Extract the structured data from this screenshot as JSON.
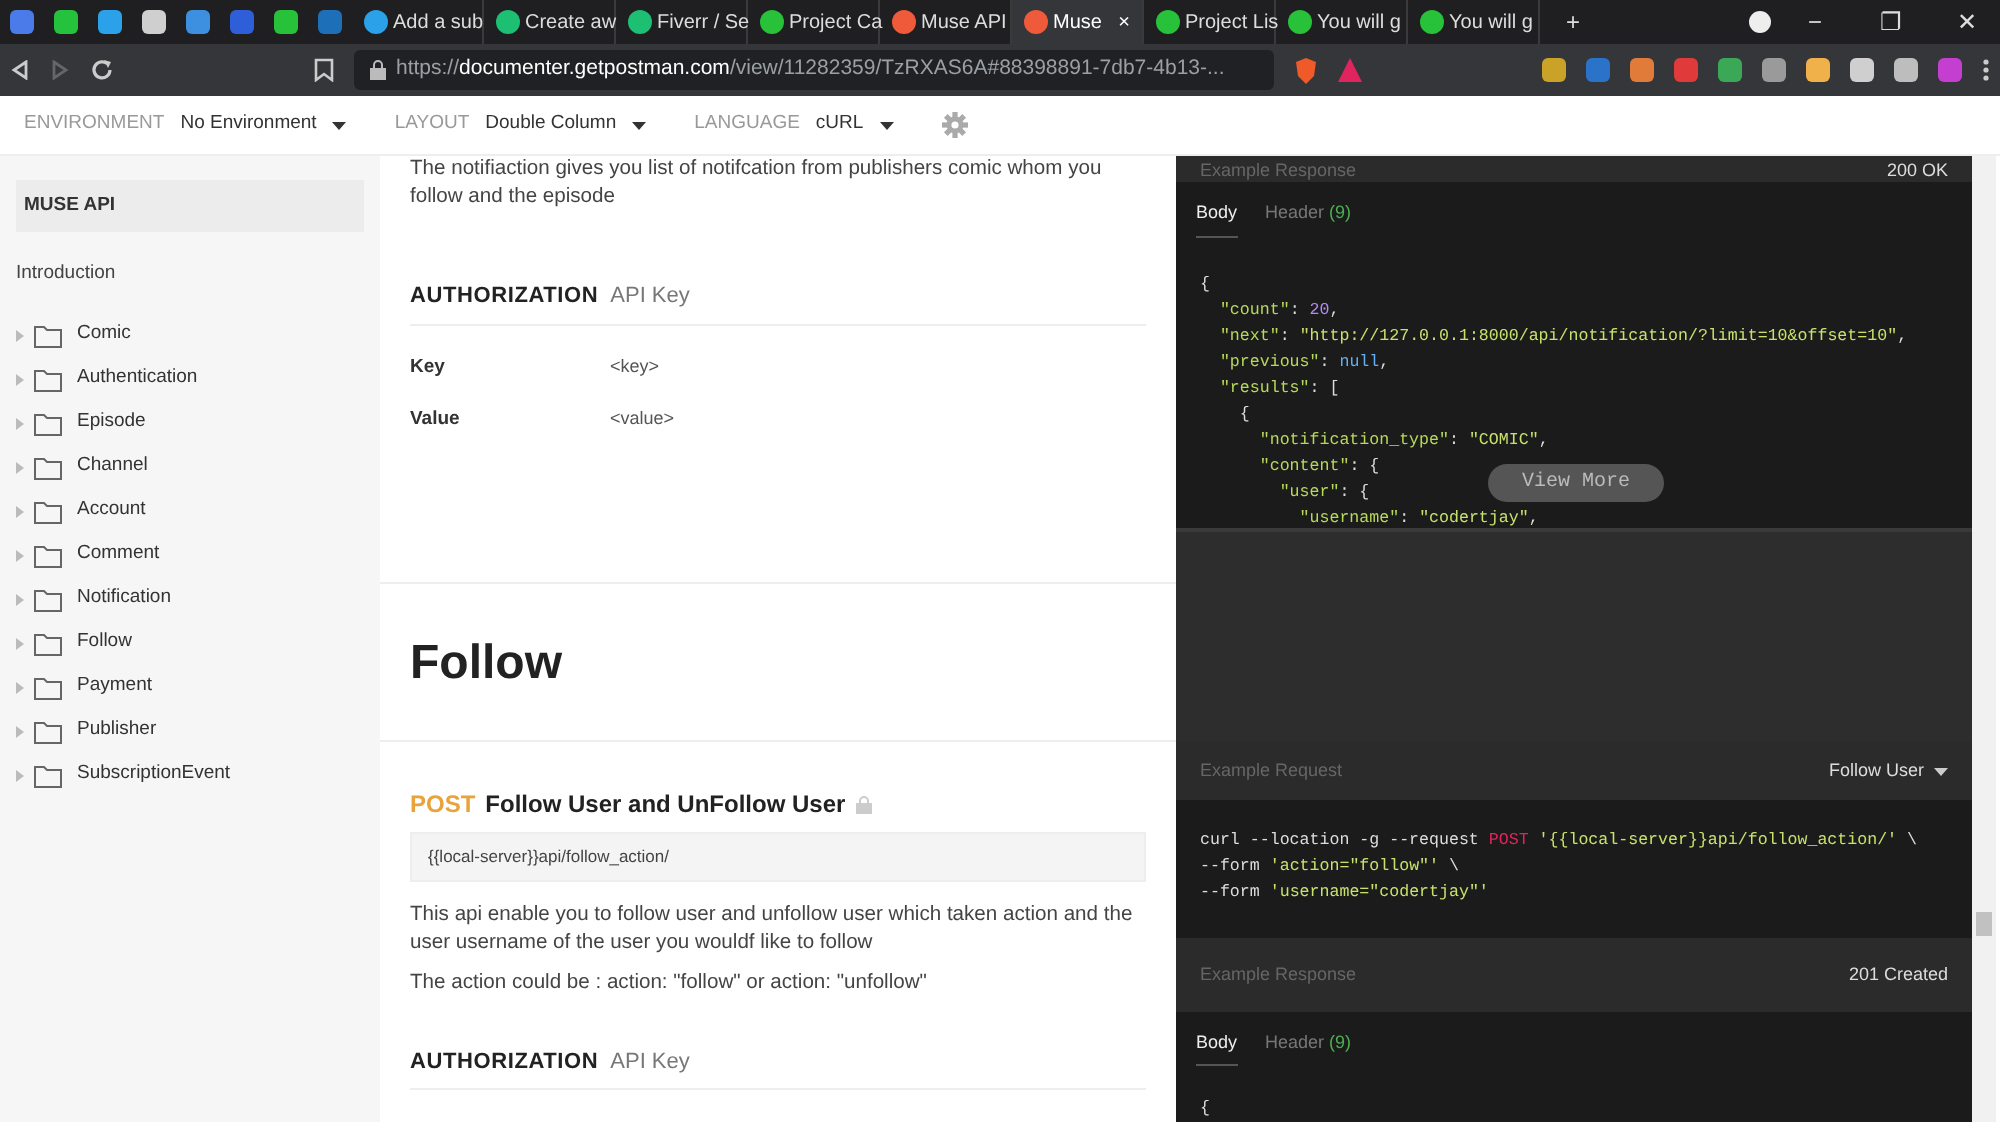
{
  "browser": {
    "tabs": [
      {
        "kind": "pinned",
        "color": "#4a7be8"
      },
      {
        "kind": "pinned",
        "color": "#25c23e"
      },
      {
        "kind": "pinned",
        "color": "#2aa1e8"
      },
      {
        "kind": "pinned",
        "color": "#cfcfcf"
      },
      {
        "kind": "pinned",
        "color": "#3d8fe0"
      },
      {
        "kind": "pinned",
        "color": "#2f5fd8"
      },
      {
        "kind": "pinned",
        "color": "#27c23a"
      },
      {
        "kind": "pinned",
        "color": "#1d6fb8"
      },
      {
        "kind": "tab",
        "label": "Add a sub",
        "color": "#2aa1e8",
        "selected": false
      },
      {
        "kind": "tab",
        "label": "Create aw",
        "color": "#1dbf73",
        "selected": false
      },
      {
        "kind": "tab",
        "label": "Fiverr / Se",
        "color": "#1dbf73",
        "selected": false
      },
      {
        "kind": "tab",
        "label": "Project Ca",
        "color": "#27c23a",
        "selected": false
      },
      {
        "kind": "tab",
        "label": "Muse API",
        "color": "#ef5b3a",
        "selected": false
      },
      {
        "kind": "tab",
        "label": "Muse",
        "color": "#ef5b3a",
        "selected": true,
        "close": "×"
      },
      {
        "kind": "tab",
        "label": "Project Lis",
        "color": "#27c23a",
        "selected": false
      },
      {
        "kind": "tab",
        "label": "You will g",
        "color": "#27c23a",
        "selected": false
      },
      {
        "kind": "tab",
        "label": "You will g",
        "color": "#27c23a",
        "selected": false
      }
    ],
    "new_tab": "+",
    "window_controls": [
      "−",
      "❐",
      "✕"
    ],
    "url": "https://**documenter.getpostman.com**/view/11282359/TzRXAS6A#88398891-7db7-4b13-...",
    "extensions": [
      {
        "color": "#c9a227"
      },
      {
        "color": "#2a73c9"
      },
      {
        "color": "#e07b39"
      },
      {
        "color": "#e03a3a"
      },
      {
        "color": "#3aa857"
      },
      {
        "color": "#9a9a9a"
      },
      {
        "color": "#f0b04a"
      },
      {
        "color": "#cfcfcf"
      },
      {
        "color": "#bdbdbd"
      },
      {
        "color": "#c43fd0"
      }
    ]
  },
  "toolbar": [
    {
      "label": "ENVIRONMENT",
      "value": "No Environment"
    },
    {
      "label": "LAYOUT",
      "value": "Double Column"
    },
    {
      "label": "LANGUAGE",
      "value": "cURL"
    }
  ],
  "sidebar": {
    "title": "MUSE API",
    "intro": "Introduction",
    "folders": [
      "Comic",
      "Authentication",
      "Episode",
      "Channel",
      "Account",
      "Comment",
      "Notification",
      "Follow",
      "Payment",
      "Publisher",
      "SubscriptionEvent"
    ]
  },
  "prev_request": {
    "description": "The notifiaction gives you list of notifcation from publishers comic whom you follow and the episode",
    "authorization": {
      "heading": "AUTHORIZATION",
      "type": "API Key",
      "rows": [
        {
          "key": "Key",
          "value": "<key>"
        },
        {
          "key": "Value",
          "value": "<value>"
        }
      ]
    },
    "response": {
      "title": "Example Response",
      "status": "200 OK",
      "tabs": [
        {
          "label": "Body",
          "selected": true
        },
        {
          "label": "Header",
          "count": "(9)",
          "selected": false
        }
      ],
      "code": [
        [
          {
            "kind": "plain",
            "text": "{"
          }
        ],
        [
          {
            "kind": "key",
            "text": "  \"count\""
          },
          {
            "kind": "plain",
            "text": ": "
          },
          {
            "kind": "number",
            "text": "20"
          },
          {
            "kind": "plain",
            "text": ","
          }
        ],
        [
          {
            "kind": "key",
            "text": "  \"next\""
          },
          {
            "kind": "plain",
            "text": ": "
          },
          {
            "kind": "string",
            "text": "\"http://127.0.0.1:8000/api/notification/?limit=10&offset=10\""
          },
          {
            "kind": "plain",
            "text": ","
          }
        ],
        [
          {
            "kind": "key",
            "text": "  \"previous\""
          },
          {
            "kind": "plain",
            "text": ": "
          },
          {
            "kind": "null",
            "text": "null"
          },
          {
            "kind": "plain",
            "text": ","
          }
        ],
        [
          {
            "kind": "key",
            "text": "  \"results\""
          },
          {
            "kind": "plain",
            "text": ": ["
          }
        ],
        [
          {
            "kind": "plain",
            "text": "    {"
          }
        ],
        [
          {
            "kind": "key",
            "text": "      \"notification_type\""
          },
          {
            "kind": "plain",
            "text": ": "
          },
          {
            "kind": "string",
            "text": "\"COMIC\""
          },
          {
            "kind": "plain",
            "text": ","
          }
        ],
        [
          {
            "kind": "key",
            "text": "      \"content\""
          },
          {
            "kind": "plain",
            "text": ": {"
          }
        ],
        [
          {
            "kind": "key",
            "text": "        \"user\""
          },
          {
            "kind": "plain",
            "text": ": {"
          }
        ],
        [
          {
            "kind": "key",
            "text": "          \"username\""
          },
          {
            "kind": "plain",
            "text": ": "
          },
          {
            "kind": "string",
            "text": "\"codertjay\""
          },
          {
            "kind": "plain",
            "text": ","
          }
        ]
      ],
      "view_more": "View More"
    }
  },
  "section": {
    "title": "Follow"
  },
  "request": {
    "method": "POST",
    "name": "Follow User and UnFollow User",
    "url": "{{local-server}}api/follow_action/",
    "paragraphs": [
      "This api enable you to follow user and unfollow user which taken action and the user username of the user you wouldf like to follow",
      "The action could be : action: \"follow\" or action: \"unfollow\""
    ],
    "authorization": {
      "heading": "AUTHORIZATION",
      "type": "API Key"
    },
    "example_request": {
      "title": "Example Request",
      "selector": "Follow User",
      "code": [
        [
          {
            "kind": "plain",
            "text": "curl --location -g --request "
          },
          {
            "kind": "method",
            "text": "POST"
          },
          {
            "kind": "string",
            "text": " '{{local-server}}api/follow_action/'"
          },
          {
            "kind": "plain",
            "text": " \\"
          }
        ],
        [
          {
            "kind": "plain",
            "text": "--form "
          },
          {
            "kind": "string",
            "text": "'action=\"follow\"'"
          },
          {
            "kind": "plain",
            "text": " \\"
          }
        ],
        [
          {
            "kind": "plain",
            "text": "--form "
          },
          {
            "kind": "string",
            "text": "'username=\"codertjay\"'"
          }
        ]
      ]
    },
    "response": {
      "title": "Example Response",
      "status": "201 Created",
      "tabs": [
        {
          "label": "Body",
          "selected": true
        },
        {
          "label": "Header",
          "count": "(9)",
          "selected": false
        }
      ],
      "code": [
        [
          {
            "kind": "plain",
            "text": "{"
          }
        ]
      ]
    }
  }
}
